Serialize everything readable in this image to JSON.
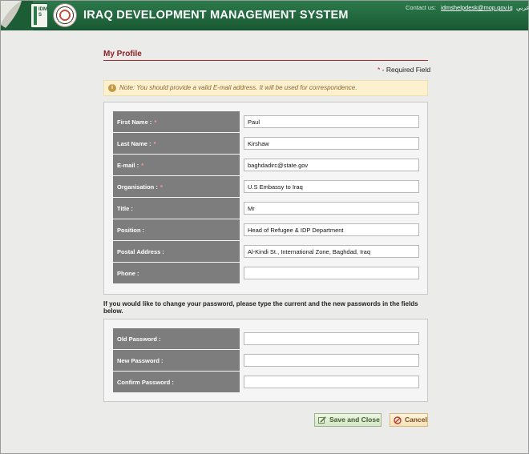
{
  "header": {
    "app_title": "IRAQ DEVELOPMENT MANAGEMENT SYSTEM",
    "logo_text": "IDMS",
    "contact_label": "Contact us:",
    "contact_email": "idmshelpdesk@mop.gov.iq",
    "language_link": "عربي"
  },
  "profile": {
    "section_title": "My Profile",
    "required_star": "*",
    "required_label": " - Required Field",
    "note": "Note: You should provide a valid E-mail address. It will be used for correspondence.",
    "fields": [
      {
        "label": "First Name :",
        "required": "*",
        "value": "Paul"
      },
      {
        "label": "Last Name :",
        "required": "*",
        "value": "Kirshaw"
      },
      {
        "label": "E-mail :",
        "required": "*",
        "value": "baghdadirc@state.gov"
      },
      {
        "label": "Organisation :",
        "required": "*",
        "value": "U.S Embassy to Iraq"
      },
      {
        "label": "Title :",
        "required": "",
        "value": "Mr"
      },
      {
        "label": "Position :",
        "required": "",
        "value": "Head of Refugee & IDP Department"
      },
      {
        "label": "Postal Address :",
        "required": "",
        "value": "Al-Kindi St., International Zone, Baghdad, Iraq"
      },
      {
        "label": "Phone :",
        "required": "",
        "value": ""
      }
    ]
  },
  "password": {
    "hint": "If you would like to change your password, please type the current and the new passwords in the fields below.",
    "fields": [
      {
        "label": "Old Password :",
        "value": ""
      },
      {
        "label": "New Password :",
        "value": ""
      },
      {
        "label": "Confirm Password :",
        "value": ""
      }
    ]
  },
  "actions": {
    "save_label": "Save and Close",
    "cancel_label": "Cancel"
  },
  "colors": {
    "header_green": "#1f6a3c",
    "accent_red": "#8d1f24",
    "label_gray": "#7d7d7d",
    "note_bg": "#fdf0cf"
  }
}
